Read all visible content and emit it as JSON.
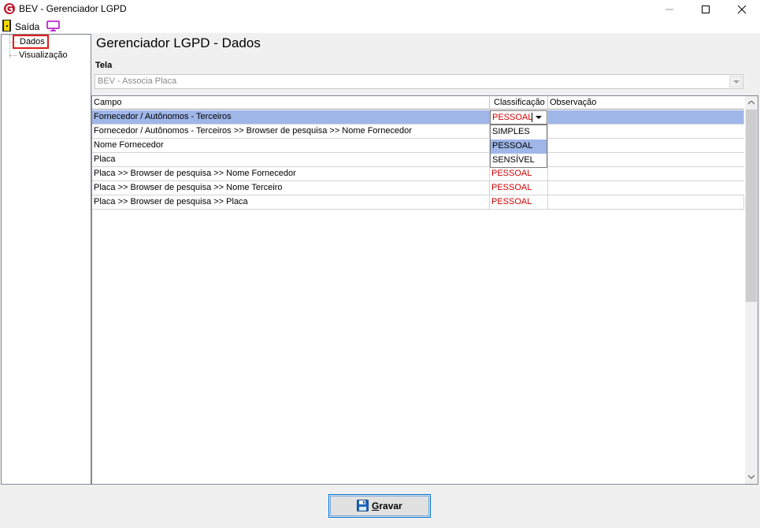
{
  "window": {
    "title": "BEV - Gerenciador LGPD"
  },
  "menu": {
    "exit_label": "Saída"
  },
  "tree": {
    "items": [
      {
        "label": "Dados",
        "selected": true
      },
      {
        "label": "Visualização",
        "selected": false
      }
    ]
  },
  "main": {
    "title": "Gerenciador LGPD - Dados",
    "tela_label": "Tela",
    "tela_value": "BEV - Associa Placa"
  },
  "grid": {
    "columns": [
      "Campo",
      "Classificação",
      "Observação"
    ],
    "rows": [
      {
        "campo": "Fornecedor / Autônomos - Terceiros",
        "classificacao": "PESSOAL",
        "observacao": ""
      },
      {
        "campo": "Fornecedor / Autônomos - Terceiros >> Browser de pesquisa >> Nome Fornecedor",
        "classificacao": "",
        "observacao": ""
      },
      {
        "campo": "Nome Fornecedor",
        "classificacao": "",
        "observacao": ""
      },
      {
        "campo": "Placa",
        "classificacao": "",
        "observacao": ""
      },
      {
        "campo": "Placa >> Browser de pesquisa >> Nome Fornecedor",
        "classificacao": "PESSOAL",
        "observacao": ""
      },
      {
        "campo": "Placa >> Browser de pesquisa >> Nome Terceiro",
        "classificacao": "PESSOAL",
        "observacao": ""
      },
      {
        "campo": "Placa >> Browser de pesquisa >> Placa",
        "classificacao": "PESSOAL",
        "observacao": ""
      }
    ],
    "dropdown_options": [
      "SIMPLES",
      "PESSOAL",
      "SENSÍVEL"
    ],
    "dropdown_highlight": "PESSOAL"
  },
  "footer": {
    "save_label_underlined": "G",
    "save_label_rest": "ravar"
  },
  "colors": {
    "selection": "#9fb6e8",
    "classification_text": "#d10000",
    "highlight_border": "#e31b1b"
  }
}
